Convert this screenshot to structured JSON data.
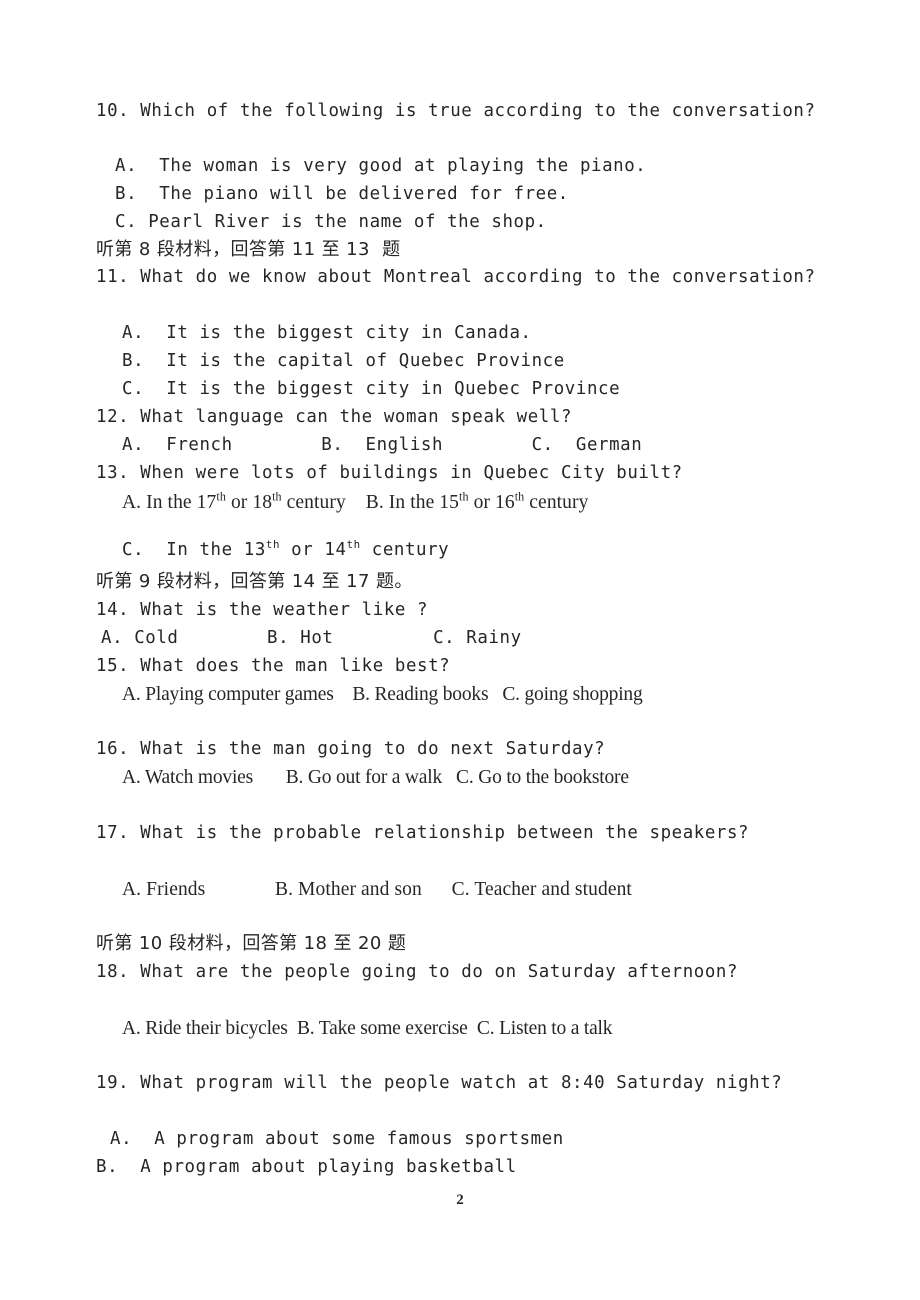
{
  "document": {
    "page_number": "2",
    "text_color": "#262626",
    "background_color": "#ffffff"
  },
  "questions": [
    {
      "number": "10.",
      "stem": "10. Which of the following is true according to the conversation?",
      "options": [
        "A.  The woman is very good at playing the piano.",
        "B.  The piano will be delivered for free.",
        "C. Pearl River is the name of the shop."
      ]
    },
    {
      "number": "11.",
      "stem": "11. What do we know about Montreal according to the conversation?",
      "options": [
        "A.  It is the biggest city in Canada.",
        "B.  It is the capital of Quebec Province",
        "C.  It is the biggest city in Quebec Province"
      ]
    },
    {
      "number": "12.",
      "stem": "12. What language can the woman speak well?",
      "options_inline": "A.  French        B.  English        C.  German"
    },
    {
      "number": "13.",
      "stem": "13. When were lots of buildings in Quebec City built?",
      "option_a_pre": "A. In the 17",
      "option_a_sup1": "th",
      "option_a_mid": " or 18",
      "option_a_sup2": "th",
      "option_a_post": " century",
      "option_b_pre": "B. In the 15",
      "option_b_sup1": "th",
      "option_b_mid": " or 16",
      "option_b_sup2": "th",
      "option_b_post": " century",
      "option_c_pre": "C.  In the 13",
      "option_c_sup1": "th",
      "option_c_mid": " or 14",
      "option_c_sup2": "th",
      "option_c_post": " century"
    },
    {
      "number": "14.",
      "stem": "14. What is the weather like ?",
      "options_inline": "A. Cold        B. Hot         C. Rainy"
    },
    {
      "number": "15.",
      "stem": "15. What does the man like best?",
      "options_inline": "A. Playing computer games    B. Reading books   C. going shopping"
    },
    {
      "number": "16.",
      "stem": "16. What is the man going to do next Saturday?",
      "options_inline": "A. Watch movies       B. Go out for a walk   C. Go to the bookstore"
    },
    {
      "number": "17.",
      "stem": "17. What is the probable relationship between the speakers?",
      "options_inline": "A. Friends              B. Mother and son      C. Teacher and student"
    },
    {
      "number": "18.",
      "stem": "18. What are the people going to do on Saturday afternoon?",
      "options_inline": "A. Ride their bicycles  B. Take some exercise  C. Listen to a talk"
    },
    {
      "number": "19.",
      "stem": "19. What program will the people watch at 8:40 Saturday night?",
      "options": [
        "A.  A program about some famous sportsmen",
        "B.  A program about playing basketball"
      ]
    }
  ],
  "section_headers": [
    "听第 8 段材料，回答第 11 至 13  题",
    "听第 9 段材料，回答第 14 至 17 题。",
    "听第 10 段材料，回答第 18 至 20 题"
  ]
}
